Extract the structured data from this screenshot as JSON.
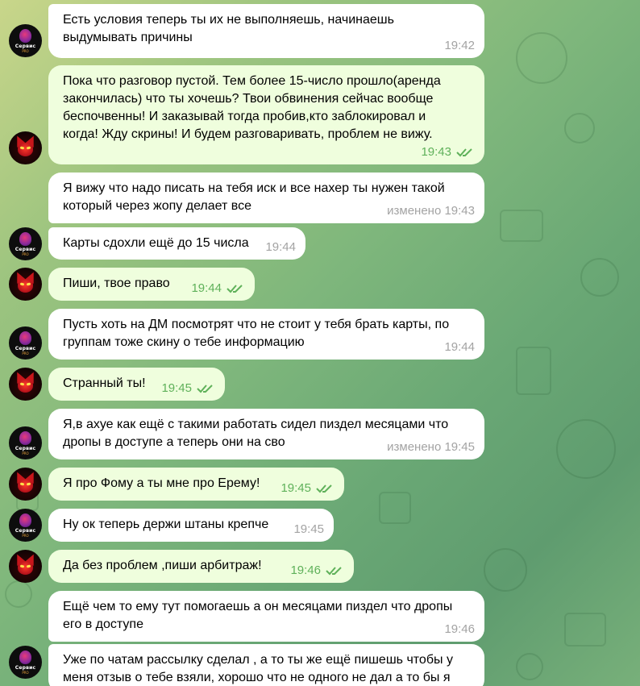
{
  "chat": {
    "messages": [
      {
        "id": "m1",
        "direction": "in",
        "avatar": "purple",
        "text": "Есть условия теперь ты их не выполняешь, начинаешь\nвыдумывать причины",
        "time": "19:42"
      },
      {
        "id": "m2",
        "direction": "out",
        "avatar": "red",
        "text": "Пока что разговор пустой. Тем более 15-число прошло(аренда\nзакончилась) что ты хочешь? Твои обвинения сейчас вообще\nбеспочвенны! И заказывай тогда пробив,кто заблокировал и\nкогда! Жду скрины! И будем разговаривать, проблем не вижу.",
        "time": "19:43",
        "read": true
      },
      {
        "id": "m3",
        "direction": "in",
        "avatar": "none",
        "text": "Я вижу что надо писать на тебя иск и все нахер ты нужен такой\nкоторый через жопу делает все",
        "time": "изменено 19:43"
      },
      {
        "id": "m4",
        "direction": "in",
        "avatar": "purple",
        "text": "Карты сдохли ещё до 15 числа",
        "time": "19:44"
      },
      {
        "id": "m5",
        "direction": "out",
        "avatar": "red",
        "text": "Пиши, твое право",
        "time": "19:44",
        "read": true
      },
      {
        "id": "m6",
        "direction": "in",
        "avatar": "purple",
        "text": "Пусть хоть на ДМ посмотрят что не стоит у тебя брать карты, по\nгруппам тоже скину о тебе информацию",
        "time": "19:44"
      },
      {
        "id": "m7",
        "direction": "out",
        "avatar": "red",
        "text": "Странный ты!",
        "time": "19:45",
        "read": true
      },
      {
        "id": "m8",
        "direction": "in",
        "avatar": "purple",
        "text": "Я,в ахуе как ещё с такими работать сидел пиздел месяцами что\nдропы в доступе а теперь они на сво",
        "time": "изменено 19:45"
      },
      {
        "id": "m9",
        "direction": "out",
        "avatar": "red",
        "text": "Я про Фому а ты мне про Ерему!",
        "time": "19:45",
        "read": true
      },
      {
        "id": "m10",
        "direction": "in",
        "avatar": "purple",
        "text": "Ну ок теперь держи штаны крепче",
        "time": "19:45"
      },
      {
        "id": "m11",
        "direction": "out",
        "avatar": "red",
        "text": "Да без проблем ,пиши арбитраж!",
        "time": "19:46",
        "read": true
      },
      {
        "id": "m12",
        "direction": "in",
        "avatar": "none",
        "text": "Ещё чем то ему тут помогаешь а он месяцами пиздел что дропы\nего в доступе",
        "time": "19:46"
      },
      {
        "id": "m13",
        "direction": "in",
        "avatar": "purple",
        "text": "Уже по чатам рассылку сделал , а то ты же ещё пишешь чтобы у\nменя отзыв о тебе взяли, хорошо что не одного не дал а то бы я",
        "time": ""
      }
    ],
    "avatar_purple_text": "Сервис",
    "avatar_purple_subtext": "PRO",
    "colors": {
      "incoming_bubble": "#ffffff",
      "outgoing_bubble": "#effedd",
      "outgoing_time": "#5fb15a",
      "incoming_time": "#a3a3a3"
    },
    "icons": {
      "read_receipt": "double-check-icon",
      "avatar_purple": "service-logo-avatar",
      "avatar_red": "demon-avatar"
    }
  }
}
